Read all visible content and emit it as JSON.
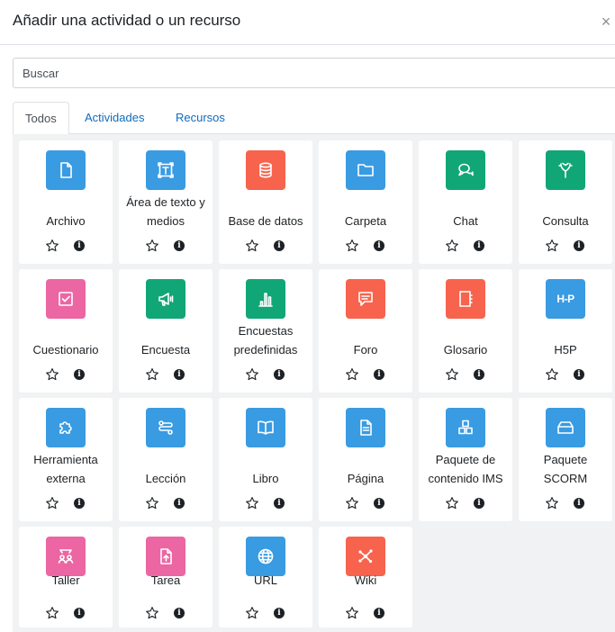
{
  "modal": {
    "title": "Añadir una actividad o un recurso",
    "close_glyph": "×"
  },
  "search": {
    "placeholder": "Buscar",
    "value": ""
  },
  "tabs": [
    {
      "label": "Todos",
      "active": true
    },
    {
      "label": "Actividades",
      "active": false
    },
    {
      "label": "Recursos",
      "active": false
    }
  ],
  "info_glyph": "i",
  "colors": {
    "blue": "#399be2",
    "green": "#11a676",
    "red": "#f7634d",
    "pink": "#eb66a2",
    "link": "#0f6cbf"
  },
  "modules": [
    {
      "label": "Archivo",
      "lines": [
        "Archivo"
      ],
      "icon": "file-icon",
      "color": "blue"
    },
    {
      "label": "Área de texto y medios",
      "lines": [
        "Área de texto y",
        "medios"
      ],
      "icon": "text-area-icon",
      "color": "blue"
    },
    {
      "label": "Base de datos",
      "lines": [
        "Base de datos"
      ],
      "icon": "database-icon",
      "color": "red"
    },
    {
      "label": "Carpeta",
      "lines": [
        "Carpeta"
      ],
      "icon": "folder-icon",
      "color": "blue"
    },
    {
      "label": "Chat",
      "lines": [
        "Chat"
      ],
      "icon": "chat-icon",
      "color": "green"
    },
    {
      "label": "Consulta",
      "lines": [
        "Consulta"
      ],
      "icon": "choice-icon",
      "color": "green"
    },
    {
      "label": "Cuestionario",
      "lines": [
        "Cuestionario"
      ],
      "icon": "quiz-icon",
      "color": "pink"
    },
    {
      "label": "Encuesta",
      "lines": [
        "Encuesta"
      ],
      "icon": "megaphone-icon",
      "color": "green"
    },
    {
      "label": "Encuestas predefinidas",
      "lines": [
        "Encuestas",
        "predefinidas"
      ],
      "icon": "bar-chart-icon",
      "color": "green"
    },
    {
      "label": "Foro",
      "lines": [
        "Foro"
      ],
      "icon": "forum-icon",
      "color": "red"
    },
    {
      "label": "Glosario",
      "lines": [
        "Glosario"
      ],
      "icon": "glossary-icon",
      "color": "red"
    },
    {
      "label": "H5P",
      "lines": [
        "H5P"
      ],
      "icon": "h5p-icon",
      "color": "blue",
      "icon_text": "H-P"
    },
    {
      "label": "Herramienta externa",
      "lines": [
        "Herramienta",
        "externa"
      ],
      "icon": "puzzle-icon",
      "color": "blue"
    },
    {
      "label": "Lección",
      "lines": [
        "Lección"
      ],
      "icon": "lesson-icon",
      "color": "blue"
    },
    {
      "label": "Libro",
      "lines": [
        "Libro"
      ],
      "icon": "book-icon",
      "color": "blue"
    },
    {
      "label": "Página",
      "lines": [
        "Página"
      ],
      "icon": "page-icon",
      "color": "blue"
    },
    {
      "label": "Paquete de contenido IMS",
      "lines": [
        "Paquete de",
        "contenido IMS"
      ],
      "icon": "ims-package-icon",
      "color": "blue"
    },
    {
      "label": "Paquete SCORM",
      "lines": [
        "Paquete",
        "SCORM"
      ],
      "icon": "scorm-package-icon",
      "color": "blue"
    },
    {
      "label": "Taller",
      "lines": [
        "Taller"
      ],
      "icon": "workshop-icon",
      "color": "pink"
    },
    {
      "label": "Tarea",
      "lines": [
        "Tarea"
      ],
      "icon": "assignment-icon",
      "color": "pink"
    },
    {
      "label": "URL",
      "lines": [
        "URL"
      ],
      "icon": "globe-icon",
      "color": "blue"
    },
    {
      "label": "Wiki",
      "lines": [
        "Wiki"
      ],
      "icon": "wiki-icon",
      "color": "red"
    }
  ]
}
